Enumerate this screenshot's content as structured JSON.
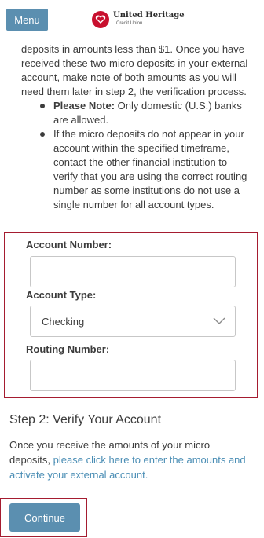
{
  "header": {
    "menu_label": "Menu",
    "logo_name": "United Heritage",
    "logo_sub": "Credit Union"
  },
  "intro": {
    "paragraph": "deposits in amounts less than $1. Once you have received these two micro deposits in your external account, make note of both amounts as you will need them later in step 2, the verification process.",
    "bullets": [
      {
        "bold": "Please Note:",
        "text": " Only domestic (U.S.) banks are allowed."
      },
      {
        "bold": "",
        "text": "If the micro deposits do not appear in your account within the specified timeframe, contact the other financial institution to verify that you are using the correct routing number as some institutions do not use a single number for all account types."
      }
    ]
  },
  "form": {
    "account_number_label": "Account Number:",
    "account_number_value": "",
    "account_type_label": "Account Type:",
    "account_type_selected": "Checking",
    "routing_number_label": "Routing Number:",
    "routing_number_value": ""
  },
  "step2": {
    "title": "Step 2: Verify Your Account",
    "text_before": "Once you receive the amounts of your micro deposits, ",
    "link_text": "please click here to enter the amounts and activate your external account."
  },
  "continue_label": "Continue",
  "colors": {
    "brand_blue": "#5b8fb0",
    "brand_red": "#c8102e",
    "highlight_border": "#a51c30",
    "link": "#4b8eb5"
  }
}
